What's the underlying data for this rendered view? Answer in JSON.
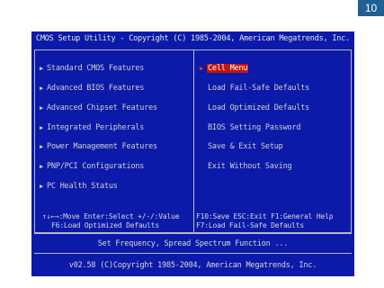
{
  "page_number": "10",
  "bios": {
    "title": "CMOS Setup Utility - Copyright (C) 1985-2004, American Megatrends, Inc.",
    "left_menu": [
      {
        "label": "Standard CMOS Features"
      },
      {
        "label": "Advanced BIOS Features"
      },
      {
        "label": "Advanced Chipset Features"
      },
      {
        "label": "Integrated Peripherals"
      },
      {
        "label": "Power Management Features"
      },
      {
        "label": "PNP/PCI Configurations"
      },
      {
        "label": "PC Health Status"
      }
    ],
    "right_menu": [
      {
        "label": "Cell Menu",
        "selected": true
      },
      {
        "label": "Load Fail-Safe Defaults"
      },
      {
        "label": "Load Optimized Defaults"
      },
      {
        "label": "BIOS Setting Password"
      },
      {
        "label": "Save & Exit Setup"
      },
      {
        "label": "Exit Without Saving"
      }
    ],
    "help": {
      "line1_left": "↑↓←→:Move  Enter:Select  +/-/:Value",
      "line1_right": "F10:Save  ESC:Exit  F1:General Help",
      "line2_left": "F6:Load Optimized Defaults",
      "line2_right": "F7:Load Fail-Safe Defaults"
    },
    "description": "Set Frequency, Spread Spectrum Function ...",
    "footer": "v02.58 (C)Copyright 1985-2004, American Megatrends, Inc."
  }
}
